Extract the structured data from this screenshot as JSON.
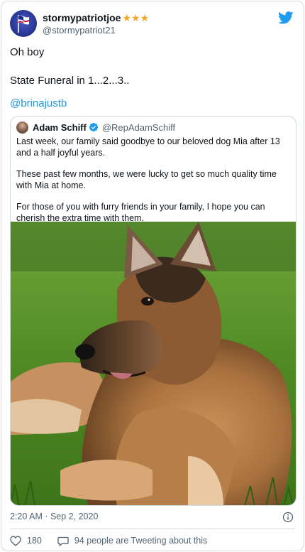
{
  "tweet": {
    "display_name": "stormypatriotjoe",
    "stars": "★★★",
    "handle": "@stormypatriot21",
    "text_line1": "Oh boy",
    "text_line2": "State Funeral in 1...2...3..",
    "mention": "@brinajustb",
    "timestamp": "2:20 AM · Sep 2, 2020",
    "like_count": "180",
    "talk_text": "94 people are Tweeting about this"
  },
  "quoted": {
    "display_name": "Adam Schiff",
    "handle": "@RepAdamSchiff",
    "paragraph1": "Last week, our family said goodbye to our beloved dog Mia after 13 and a half joyful years.",
    "paragraph2": "These past few months, we were lucky to get so much quality time with Mia at home.",
    "paragraph3": "For those of you with furry friends in your family, I hope you can cherish the extra time with them."
  },
  "colors": {
    "link": "#1b95e0",
    "stars": "#f5a623",
    "verified": "#1d9bf0",
    "twitter_blue": "#1d9bf0",
    "secondary_text": "#536471"
  },
  "icons": [
    "twitter-bird-icon",
    "verified-badge-icon",
    "info-icon",
    "heart-icon",
    "comment-icon"
  ]
}
